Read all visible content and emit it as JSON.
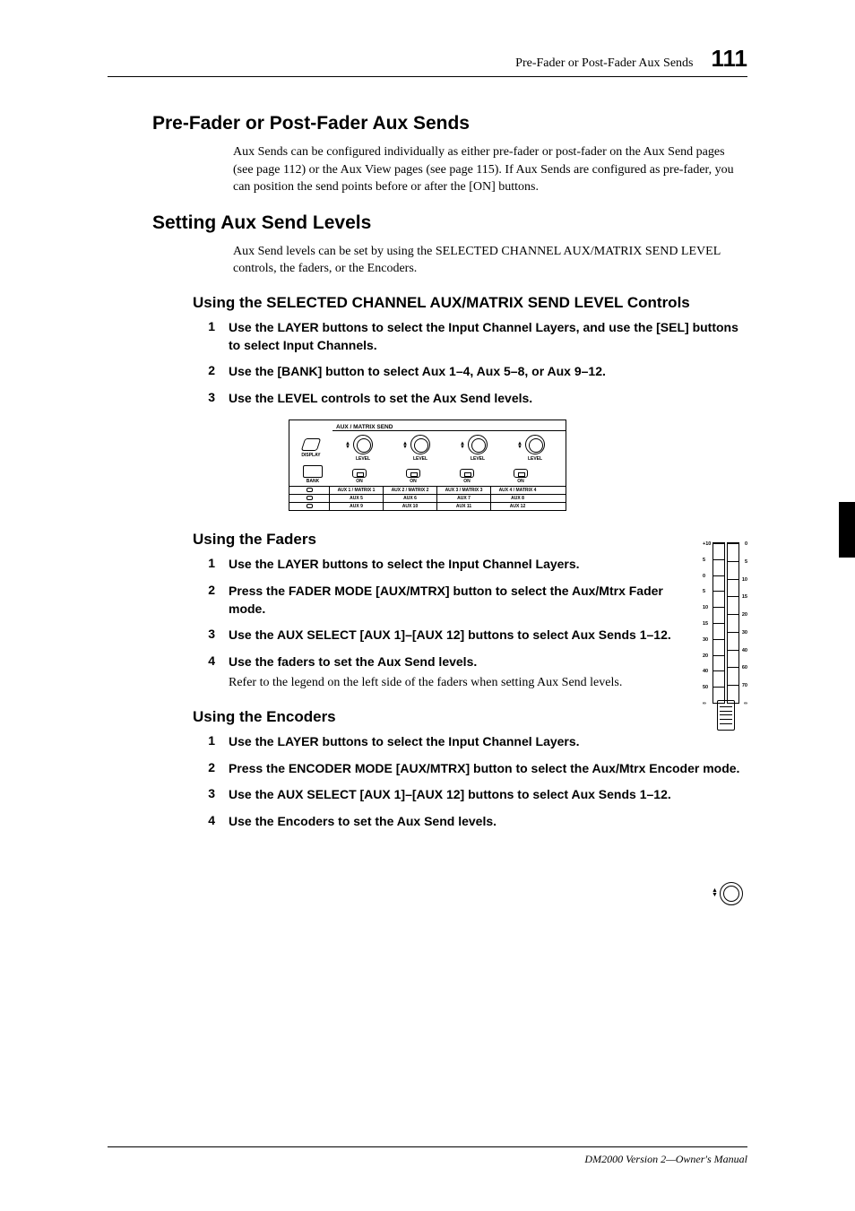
{
  "header": {
    "title": "Pre-Fader or Post-Fader Aux Sends",
    "page": "111"
  },
  "section1": {
    "heading": "Pre-Fader or Post-Fader Aux Sends",
    "body": "Aux Sends can be configured individually as either pre-fader or post-fader on the Aux Send pages (see page 112) or the Aux View pages (see page 115). If Aux Sends are configured as pre-fader, you can position the send points before or after the [ON] buttons."
  },
  "section2": {
    "heading": "Setting Aux Send Levels",
    "body": "Aux Send levels can be set by using the SELECTED CHANNEL AUX/MATRIX SEND LEVEL controls, the faders, or the Encoders."
  },
  "sub_controls": {
    "heading": "Using the SELECTED CHANNEL AUX/MATRIX SEND LEVEL Controls",
    "steps": [
      "Use the LAYER buttons to select the Input Channel Layers, and use the [SEL] buttons to select Input Channels.",
      "Use the [BANK] button to select Aux 1–4, Aux 5–8, or Aux 9–12.",
      "Use the LEVEL controls to set the Aux Send levels."
    ]
  },
  "panel": {
    "title": "AUX / MATRIX SEND",
    "display": "DISPLAY",
    "level": "LEVEL",
    "bank": "BANK",
    "on": "ON",
    "rows": [
      [
        "AUX 1 / MATRIX 1",
        "AUX 2 / MATRIX 2",
        "AUX 3 / MATRIX 3",
        "AUX 4 / MATRIX 4"
      ],
      [
        "AUX 5",
        "AUX 6",
        "AUX 7",
        "AUX 8"
      ],
      [
        "AUX 9",
        "AUX 10",
        "AUX 11",
        "AUX 12"
      ]
    ]
  },
  "sub_faders": {
    "heading": "Using the Faders",
    "steps": [
      {
        "t": "Use the LAYER buttons to select the Input Channel Layers."
      },
      {
        "t": "Press the FADER MODE [AUX/MTRX] button to select the Aux/Mtrx Fader mode."
      },
      {
        "t": "Use the AUX SELECT [AUX 1]–[AUX 12] buttons to select Aux Sends 1–12."
      },
      {
        "t": "Use the faders to set the Aux Send levels.",
        "note": "Refer to the legend on the left side of the faders when setting Aux Send levels."
      }
    ]
  },
  "fader_scale": {
    "left": [
      "+10",
      "5",
      "0",
      "5",
      "10",
      "15",
      "30",
      "20",
      "40",
      "50",
      "∞"
    ],
    "right": [
      "0",
      "5",
      "10",
      "15",
      "20",
      "30",
      "40",
      "60",
      "70",
      "∞"
    ]
  },
  "sub_encoders": {
    "heading": "Using the Encoders",
    "steps": [
      "Use the LAYER buttons to select the Input Channel Layers.",
      "Press the ENCODER MODE [AUX/MTRX] button to select the Aux/Mtrx Encoder mode.",
      "Use the AUX SELECT [AUX 1]–[AUX 12] buttons to select Aux Sends 1–12.",
      "Use the Encoders to set the Aux Send levels."
    ]
  },
  "footer": "DM2000 Version 2—Owner's Manual"
}
